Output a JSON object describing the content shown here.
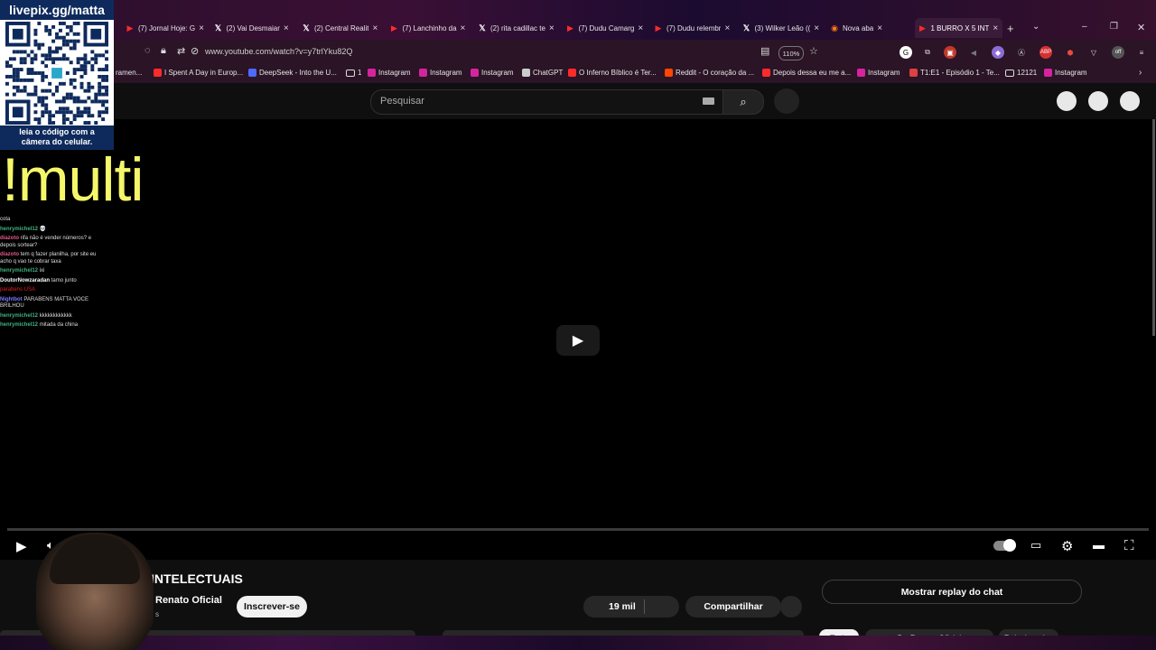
{
  "tabs": [
    {
      "icon": "youtube",
      "title": "(7) Jornal Hoje: G"
    },
    {
      "icon": "x",
      "title": "(2) Vai Desmaiar"
    },
    {
      "icon": "x",
      "title": "(2) Central Realit"
    },
    {
      "icon": "youtube",
      "title": "(7) Lanchinho da"
    },
    {
      "icon": "x",
      "title": "(2) rita cadillac te"
    },
    {
      "icon": "youtube",
      "title": "(7) Dudu Camarg"
    },
    {
      "icon": "youtube",
      "title": "(7) Dudu relembr"
    },
    {
      "icon": "x",
      "title": "(3) Wilker Leão (("
    },
    {
      "icon": "firefox",
      "title": "Nova aba"
    },
    {
      "icon": "youtube",
      "title": "1 BURRO X 5 INT"
    }
  ],
  "new_tab": "+",
  "address": {
    "url": "www.youtube.com/watch?v=y7trlYku82Q",
    "zoom": "110%"
  },
  "bookmarks": [
    {
      "icon": "none",
      "label": "ramen..."
    },
    {
      "icon": "youtube",
      "label": "I Spent A Day in Europ..."
    },
    {
      "icon": "deepseek",
      "label": "DeepSeek - Into the U..."
    },
    {
      "icon": "folder",
      "label": "1"
    },
    {
      "icon": "instagram",
      "label": "Instagram"
    },
    {
      "icon": "instagram",
      "label": "Instagram"
    },
    {
      "icon": "instagram",
      "label": "Instagram"
    },
    {
      "icon": "chatgpt",
      "label": "ChatGPT"
    },
    {
      "icon": "youtube",
      "label": "O Inferno Bíblico é Ter..."
    },
    {
      "icon": "reddit",
      "label": "Reddit - O coração da ..."
    },
    {
      "icon": "youtube",
      "label": "Depois dessa eu me a..."
    },
    {
      "icon": "instagram",
      "label": "Instagram"
    },
    {
      "icon": "tv",
      "label": "T1:E1 - Episódio 1 - Te..."
    },
    {
      "icon": "folder",
      "label": "12121"
    },
    {
      "icon": "instagram",
      "label": "Instagram"
    }
  ],
  "search": {
    "placeholder": "Pesquisar"
  },
  "overlay": {
    "qr_title": "livepix.gg/matta",
    "qr_caption_line1": "leia o código com a",
    "qr_caption_line2": "câmera do celular.",
    "command": "!multi"
  },
  "chat": [
    {
      "user": "",
      "text": "cota",
      "color": "#ddd"
    },
    {
      "user": "henrymichel12",
      "text": "💀",
      "color": "#3fb27f"
    },
    {
      "user": "diazoto",
      "text": "rifa não é vender números? e depois sortear?",
      "color": "#e05a8c"
    },
    {
      "user": "diazoto",
      "text": "tem q fazer planilha, por site eu acho q vao te cobrar taxa",
      "color": "#e05a8c"
    },
    {
      "user": "henrymichel12",
      "text": "ixi",
      "color": "#3fb27f"
    },
    {
      "user": "DoutorNowzaradan",
      "text": "tamo junto",
      "color": "#ffffff"
    },
    {
      "user": "",
      "text": "parabens USA",
      "color": "#e02020"
    },
    {
      "user": "Nightbot",
      "text": "PARABENS MATTA VOCE BRILHOU",
      "color": "#7a7aff"
    },
    {
      "user": "henrymichel12",
      "text": "kkkkkkkkkkkk",
      "color": "#3fb27f"
    },
    {
      "user": "henrymichel12",
      "text": "mitada da china",
      "color": "#3fb27f"
    }
  ],
  "video": {
    "title": "INTELECTUAIS",
    "channel": "Renato Oficial",
    "subs": "s",
    "subscribe": "Inscrever-se",
    "likes": "19 mil",
    "share": "Compartilhar",
    "chat_replay": "Mostrar replay do chat"
  },
  "chips": [
    "Tudo",
    "De Renato Oficial",
    "Relacionados"
  ]
}
